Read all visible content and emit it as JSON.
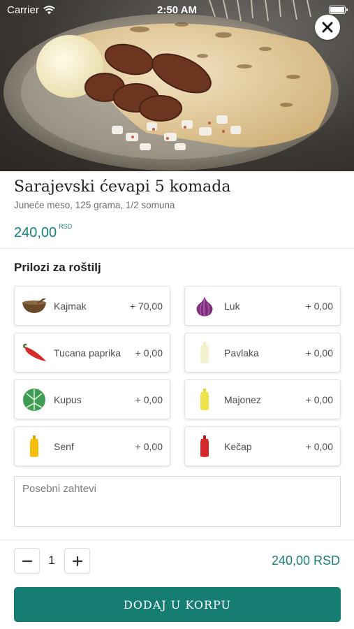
{
  "status_bar": {
    "carrier": "Carrier",
    "time": "2:50 AM"
  },
  "product": {
    "name": "Sarajevski ćevapi 5 komada",
    "description": "Juneće meso, 125 grama, 1/2 somuna",
    "price": "240,00",
    "currency": "RSD"
  },
  "section_title": "Prilozi za roštilj",
  "options": [
    {
      "name": "Kajmak",
      "extra": "+ 70,00",
      "icon": "bowl-icon"
    },
    {
      "name": "Luk",
      "extra": "+ 0,00",
      "icon": "onion-icon"
    },
    {
      "name": "Tucana paprika",
      "extra": "+ 0,00",
      "icon": "chili-pepper-icon"
    },
    {
      "name": "Pavlaka",
      "extra": "+ 0,00",
      "icon": "cream-bottle-icon"
    },
    {
      "name": "Kupus",
      "extra": "+ 0,00",
      "icon": "cabbage-icon"
    },
    {
      "name": "Majonez",
      "extra": "+ 0,00",
      "icon": "mayonnaise-bottle-icon"
    },
    {
      "name": "Senf",
      "extra": "+ 0,00",
      "icon": "mustard-bottle-icon"
    },
    {
      "name": "Kečap",
      "extra": "+ 0,00",
      "icon": "ketchup-bottle-icon"
    }
  ],
  "special_requests": {
    "placeholder": "Posebni zahtevi",
    "value": ""
  },
  "quantity": {
    "value": "1"
  },
  "total": "240,00 RSD",
  "add_to_cart_label": "DODAJ U KORPU",
  "colors": {
    "accent": "#167f78",
    "button": "#167d73"
  }
}
